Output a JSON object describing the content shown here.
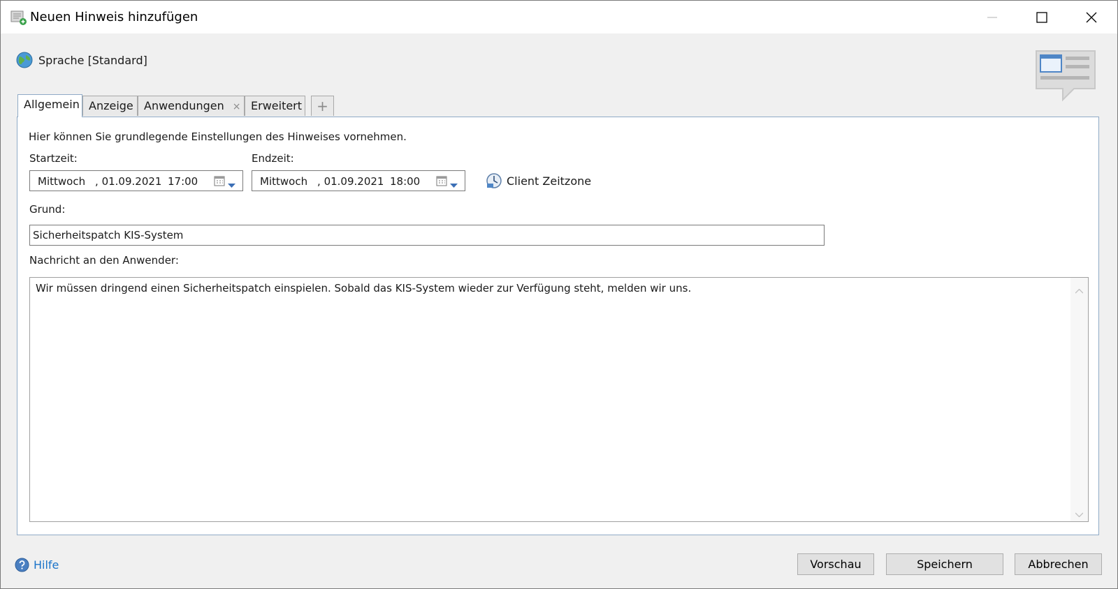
{
  "window": {
    "title": "Neuen Hinweis hinzufügen"
  },
  "language": {
    "label": "Sprache [Standard]"
  },
  "tabs": [
    {
      "label": "Allgemein",
      "active": true
    },
    {
      "label": "Anzeige"
    },
    {
      "label": "Anwendungen",
      "closable": true,
      "close_glyph": "×"
    },
    {
      "label": "Erweitert"
    }
  ],
  "tab_add_glyph": "+",
  "general": {
    "intro": "Hier können Sie grundlegende Einstellungen des Hinweises vornehmen.",
    "start": {
      "label": "Startzeit:",
      "day": "Mittwoch",
      "sep": ",",
      "date": "01.09.2021",
      "time": "17:00"
    },
    "end": {
      "label": "Endzeit:",
      "day": "Mittwoch",
      "sep": ",",
      "date": "01.09.2021",
      "time": "18:00"
    },
    "timezone_label": "Client Zeitzone",
    "reason": {
      "label": "Grund:",
      "value": "Sicherheitspatch KIS-System"
    },
    "message": {
      "label": "Nachricht an den Anwender:",
      "value": "Wir müssen dringend einen Sicherheitspatch einspielen. Sobald das KIS-System wieder zur Verfügung steht, melden wir uns."
    }
  },
  "footer": {
    "help_label": "Hilfe",
    "preview_label": "Vorschau",
    "save_label": "Speichern",
    "cancel_label": "Abbrechen"
  },
  "colors": {
    "accent_border": "#8faac6",
    "link": "#1a73c9"
  }
}
